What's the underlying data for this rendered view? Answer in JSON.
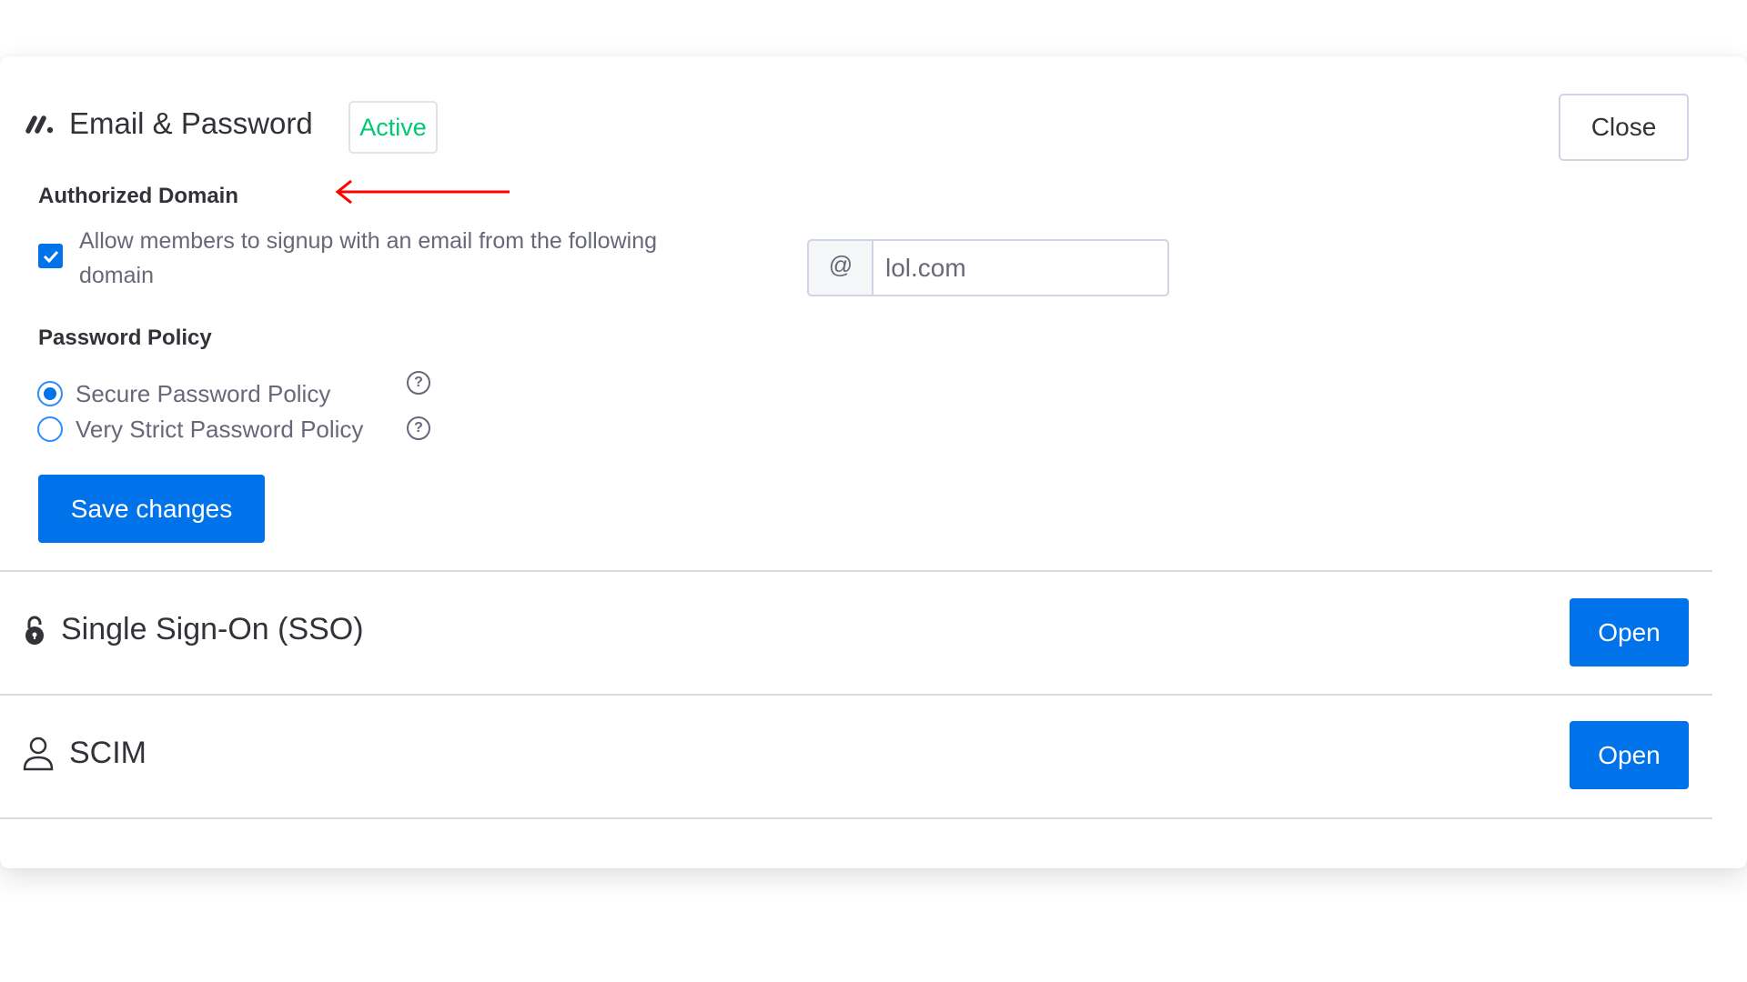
{
  "email_password": {
    "title": "Email & Password",
    "status_badge": "Active",
    "close_label": "Close",
    "authorized_domain": {
      "heading": "Authorized Domain",
      "checkbox_label": "Allow members to signup with an email from the following domain",
      "checked": true,
      "prefix": "@",
      "domain_value": "lol.com"
    },
    "password_policy": {
      "heading": "Password Policy",
      "options": [
        {
          "label": "Secure Password Policy",
          "selected": true
        },
        {
          "label": "Very Strict Password Policy",
          "selected": false
        }
      ]
    },
    "save_label": "Save changes"
  },
  "sections": [
    {
      "title": "Single Sign-On (SSO)",
      "icon": "lock-icon",
      "button_label": "Open"
    },
    {
      "title": "SCIM",
      "icon": "user-icon",
      "button_label": "Open"
    }
  ],
  "colors": {
    "accent": "#0073ea",
    "active": "#00c875",
    "annotation_arrow": "#ff0000"
  }
}
